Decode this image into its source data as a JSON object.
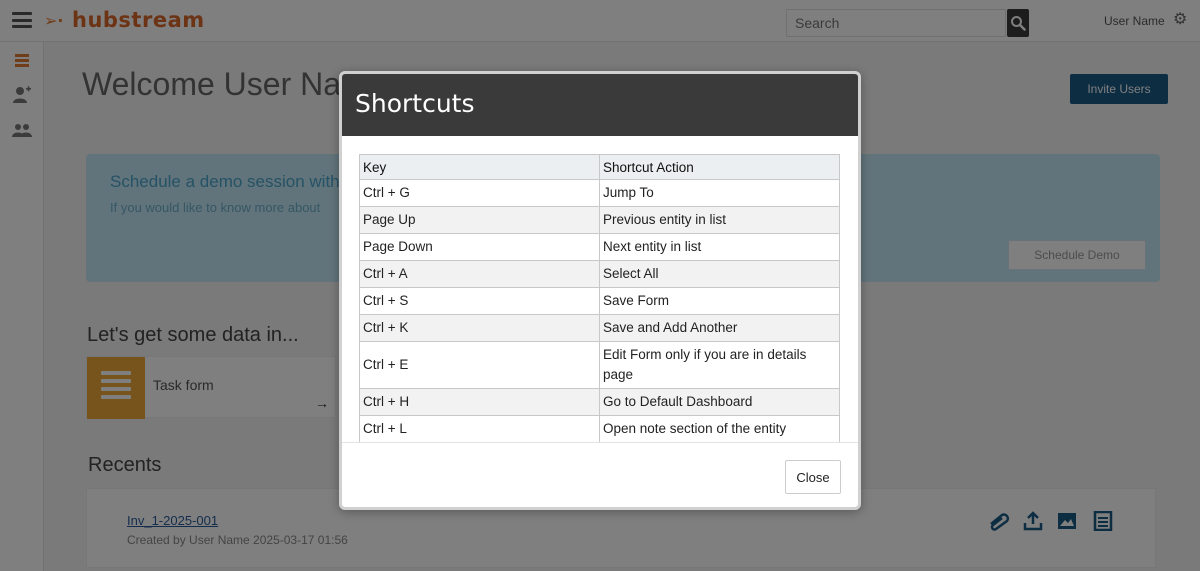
{
  "header": {
    "logo_text": "hubstream",
    "search_placeholder": "Search",
    "user_name": "User Name"
  },
  "page": {
    "welcome": "Welcome User Name",
    "invite_label": "Invite Users"
  },
  "demo": {
    "title": "Schedule a demo session with",
    "subtitle": "If you would like to know more about",
    "button": "Schedule Demo"
  },
  "data_section": {
    "title": "Let's get some data in...",
    "task_label": "Task form",
    "arrow": "→"
  },
  "recents": {
    "title": "Recents",
    "link": "Inv_1-2025-001",
    "meta": "Created by User Name 2025-03-17 01:56"
  },
  "modal": {
    "title": "Shortcuts",
    "columns": [
      "Key",
      "Shortcut Action"
    ],
    "rows": [
      {
        "key": "Ctrl + G",
        "action": "Jump To"
      },
      {
        "key": "Page Up",
        "action": "Previous entity in list"
      },
      {
        "key": "Page Down",
        "action": "Next entity in list"
      },
      {
        "key": "Ctrl + A",
        "action": "Select All"
      },
      {
        "key": "Ctrl + S",
        "action": "Save Form"
      },
      {
        "key": "Ctrl + K",
        "action": "Save and Add Another"
      },
      {
        "key": "Ctrl + E",
        "action": "Edit Form only if you are in details page"
      },
      {
        "key": "Ctrl + H",
        "action": "Go to Default Dashboard"
      },
      {
        "key": "Ctrl + L",
        "action": "Open note section of the entity"
      }
    ],
    "close_label": "Close"
  },
  "colors": {
    "brand": "#d9662a",
    "modal_header": "#3a3a3a",
    "banner": "#c5e8f6",
    "task_icon": "#f0a93a"
  },
  "icons": {
    "menu": "hamburger-menu-icon",
    "search": "search-icon",
    "settings": "gear-icon"
  }
}
